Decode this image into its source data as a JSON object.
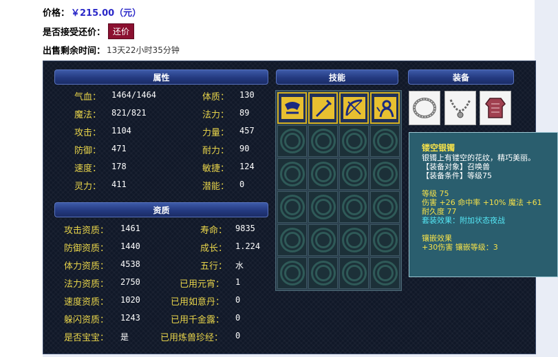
{
  "info": {
    "price_label": "价格：",
    "price_value": "￥215.00（元）",
    "counter_label": "是否接受还价：",
    "counter_button": "还价",
    "time_label": "出售剩余时间：",
    "time_value": "13天22小时35分钟"
  },
  "sections": {
    "attributes": "属性",
    "skills": "技能",
    "equipment": "装备",
    "aptitude": "资质"
  },
  "attributes": {
    "left": [
      {
        "label": "气血：",
        "value": "1464/1464"
      },
      {
        "label": "魔法：",
        "value": "821/821"
      },
      {
        "label": "攻击：",
        "value": "1104"
      },
      {
        "label": "防御：",
        "value": "471"
      },
      {
        "label": "速度：",
        "value": "178"
      },
      {
        "label": "灵力：",
        "value": "411"
      }
    ],
    "right": [
      {
        "label": "体质：",
        "value": "130"
      },
      {
        "label": "法力：",
        "value": "89"
      },
      {
        "label": "力量：",
        "value": "457"
      },
      {
        "label": "耐力：",
        "value": "90"
      },
      {
        "label": "敏捷：",
        "value": "124"
      },
      {
        "label": "潜能：",
        "value": "0"
      }
    ]
  },
  "aptitude": {
    "left": [
      {
        "label": "攻击资质：",
        "value": "1461"
      },
      {
        "label": "防御资质：",
        "value": "1440"
      },
      {
        "label": "体力资质：",
        "value": "4538"
      },
      {
        "label": "法力资质：",
        "value": "2750"
      },
      {
        "label": "速度资质：",
        "value": "1020"
      },
      {
        "label": "躲闪资质：",
        "value": "1243"
      },
      {
        "label": "是否宝宝：",
        "value": "是"
      }
    ],
    "right": [
      {
        "label": "寿命：",
        "value": "9835"
      },
      {
        "label": "成长：",
        "value": "1.224"
      },
      {
        "label": "五行：",
        "value": "水"
      },
      {
        "label": "已用元宵：",
        "value": "1"
      },
      {
        "label": "已用如意丹：",
        "value": "0"
      },
      {
        "label": "已用千金露：",
        "value": "0"
      },
      {
        "label": "已用炼兽珍经：",
        "value": "0"
      }
    ]
  },
  "skills": [
    "skill-icon-1",
    "skill-icon-2",
    "skill-icon-3",
    "skill-icon-4"
  ],
  "equipment": [
    "silver-bracelet-icon",
    "necklace-icon",
    "armor-icon"
  ],
  "tooltip": {
    "name": "镂空银镯",
    "desc": "银镯上有镂空的花纹，精巧美丽。",
    "target": "【装备对象】召唤兽",
    "requirement": "【装备条件】等级75",
    "level": "等级 75",
    "stats": "伤害 +26 命中率 +10% 魔法 +61",
    "durability": "耐久度 77",
    "set_effect": "套装效果：附加状态夜战",
    "inlay_title": "镶嵌效果",
    "inlay_detail": "+30伤害 镶嵌等级：3"
  },
  "colors": {
    "label_yellow": "#e8d44a",
    "price_blue": "#2a28c8",
    "counter_red": "#8b1030",
    "tooltip_bg": "#2a5e6e",
    "tooltip_cyan": "#54e6f4"
  }
}
